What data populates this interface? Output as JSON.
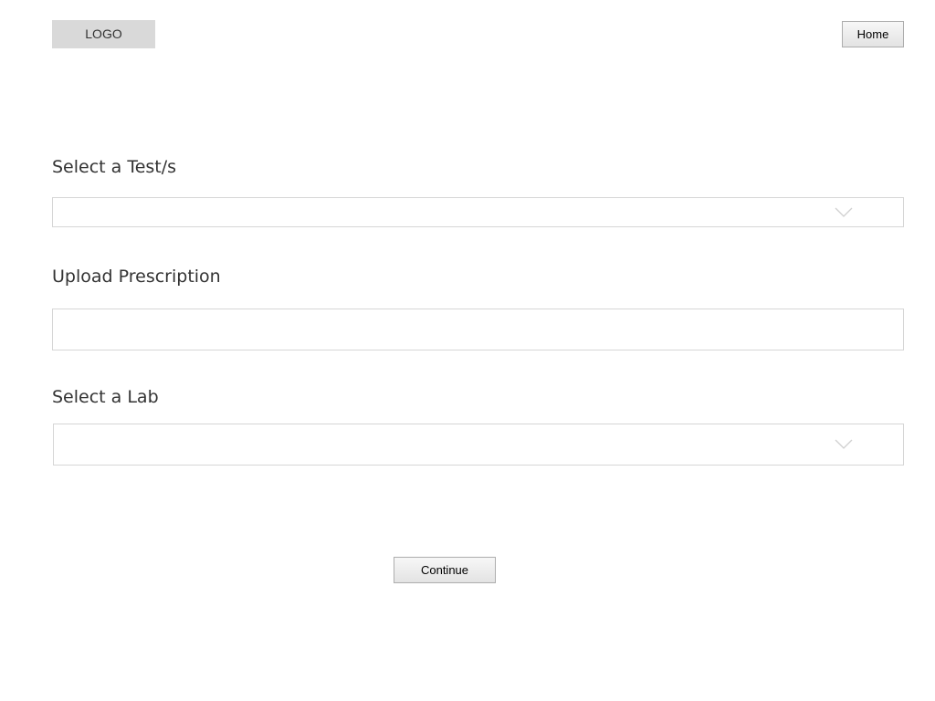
{
  "header": {
    "logo_text": "LOGO",
    "home_label": "Home"
  },
  "form": {
    "tests": {
      "label": "Select a Test/s",
      "value": ""
    },
    "prescription": {
      "label": "Upload Prescription",
      "value": ""
    },
    "lab": {
      "label": "Select a Lab",
      "value": ""
    },
    "continue_label": "Continue"
  },
  "icons": {
    "dropdown": "chevron-down-icon"
  },
  "colors": {
    "logo_bg": "#d9d9d9",
    "field_border": "#d6d6d6",
    "label_text": "#333333"
  }
}
